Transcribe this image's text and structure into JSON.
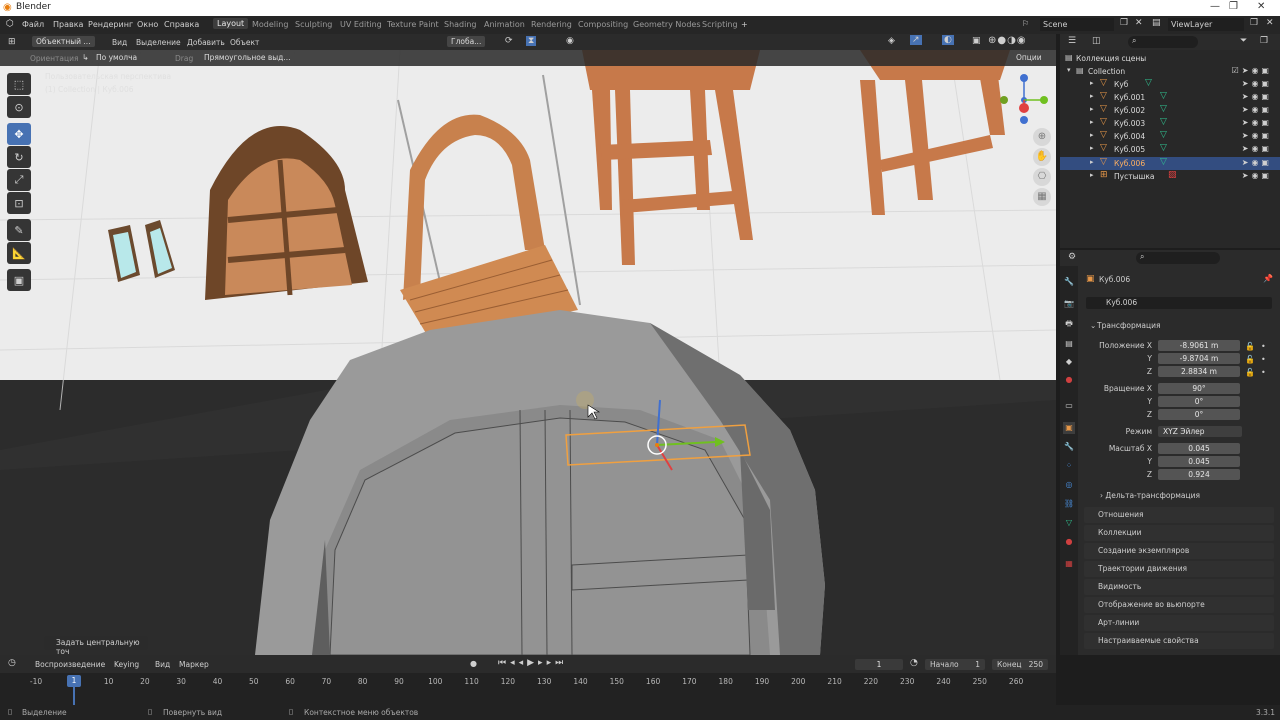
{
  "title": "Blender",
  "window_controls": [
    "—",
    "❐",
    "✕"
  ],
  "menu": [
    "Файл",
    "Правка",
    "Рендеринг",
    "Окно",
    "Справка"
  ],
  "workspaces": [
    "Layout",
    "Modeling",
    "Sculpting",
    "UV Editing",
    "Texture Paint",
    "Shading",
    "Animation",
    "Rendering",
    "Compositing",
    "Geometry Nodes",
    "Scripting"
  ],
  "active_workspace": "Layout",
  "scene": "Scene",
  "viewlayer": "ViewLayer",
  "viewport_header": {
    "mode": "Объектный ...",
    "menus": [
      "Вид",
      "Выделение",
      "Добавить",
      "Объект"
    ],
    "transform": "Глоба...",
    "orientation_label": "Ориентация",
    "orientation_value": "По умолча",
    "drag_label": "Drag",
    "drag_value": "Прямоугольное выд...",
    "options": "Опции"
  },
  "viewport": {
    "view_name": "Пользовательская перспектива",
    "collection_info": "(1) Collection | Куб.006",
    "last_op": "Задать центральную точ"
  },
  "outliner": {
    "scene_collection": "Коллекция сцены",
    "collection": "Collection",
    "items": [
      "Куб",
      "Куб.001",
      "Куб.002",
      "Куб.003",
      "Куб.004",
      "Куб.005",
      "Куб.006",
      "Пустышка"
    ],
    "selected": "Куб.006"
  },
  "properties": {
    "object_name": "Куб.006",
    "object_field": "Куб.006",
    "transform_title": "Трансформация",
    "location_label": "Положение X",
    "location": [
      "-8.9061 m",
      "-9.8704 m",
      "2.8834 m"
    ],
    "rotation_label": "Вращение X",
    "rotation": [
      "90°",
      "0°",
      "0°"
    ],
    "mode_label": "Режим",
    "mode_value": "XYZ Эйлер",
    "scale_label": "Масштаб X",
    "scale": [
      "0.045",
      "0.045",
      "0.924"
    ],
    "axis_y": "Y",
    "axis_z": "Z",
    "delta": "Дельта-трансформация",
    "sections": [
      "Отношения",
      "Коллекции",
      "Создание экземпляров",
      "Траектории движения",
      "Видимость",
      "Отображение во вьюпорте",
      "Арт-линии",
      "Настраиваемые свойства"
    ]
  },
  "timeline": {
    "menus": [
      "Воспроизведение",
      "Keying",
      "Вид",
      "Маркер"
    ],
    "current_frame": "1",
    "start_label": "Начало",
    "start_value": "1",
    "end_label": "Конец",
    "end_value": "250",
    "ticks": [
      "-10",
      "10",
      "20",
      "30",
      "40",
      "50",
      "60",
      "70",
      "80",
      "90",
      "100",
      "110",
      "120",
      "130",
      "140",
      "150",
      "160",
      "170",
      "180",
      "190",
      "200",
      "210",
      "220",
      "230",
      "240",
      "250",
      "260"
    ],
    "playhead": "1"
  },
  "status": {
    "select": "Выделение",
    "rotate": "Повернуть вид",
    "context": "Контекстное меню объектов",
    "version": "3.3.1"
  }
}
